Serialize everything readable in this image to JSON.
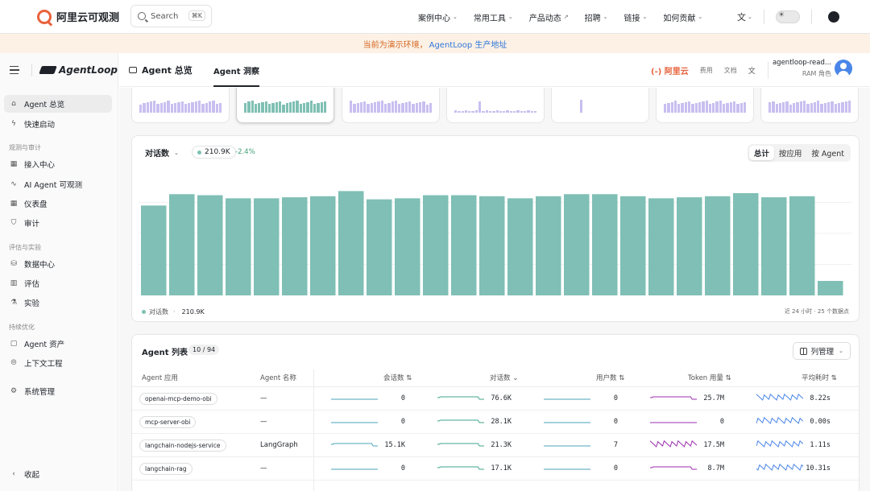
{
  "topnav": {
    "brand": "阿里云可观测",
    "search_label": "Search",
    "search_kbd": "⌘K",
    "links": [
      {
        "label": "案例中心",
        "suffix": "chevron"
      },
      {
        "label": "常用工具",
        "suffix": "chevron"
      },
      {
        "label": "产品动态",
        "suffix": "external"
      },
      {
        "label": "招聘",
        "suffix": "chevron"
      },
      {
        "label": "链接",
        "suffix": "chevron"
      },
      {
        "label": "如何贡献",
        "suffix": "chevron"
      }
    ]
  },
  "banner": {
    "text": "当前为演示环境，",
    "link": "AgentLoop 生产地址"
  },
  "sidebar": {
    "logo": "AgentLoop",
    "groups": [
      "观测与审计",
      "评估与实验",
      "持续优化"
    ],
    "items": [
      {
        "label": "Agent 总览",
        "icon": "home-icon"
      },
      {
        "label": "快速启动",
        "icon": "bolt-icon"
      },
      {
        "label": "接入中心",
        "icon": "grid-icon"
      },
      {
        "label": "AI Agent 可观测",
        "icon": "pulse-icon"
      },
      {
        "label": "仪表盘",
        "icon": "dashboard-icon"
      },
      {
        "label": "审计",
        "icon": "shield-icon"
      },
      {
        "label": "数据中心",
        "icon": "database-icon"
      },
      {
        "label": "评估",
        "icon": "chart-icon"
      },
      {
        "label": "实验",
        "icon": "flask-icon"
      },
      {
        "label": "Agent 资产",
        "icon": "folder-icon"
      },
      {
        "label": "上下文工程",
        "icon": "context-icon"
      },
      {
        "label": "系统管理",
        "icon": "settings-icon"
      }
    ],
    "collapse": "收起"
  },
  "header": {
    "tab1": "Agent 总览",
    "tab2": "Agent 洞察",
    "aliyun": "(-) 阿里云",
    "fee": "费用",
    "docs": "文档",
    "user": "agentloop-read...",
    "role": "RAM 角色"
  },
  "chart_card": {
    "metric": "对话数",
    "value": "210.9K",
    "delta": "-2.4%",
    "segments": [
      "总计",
      "按应用",
      "按 Agent"
    ],
    "legend_label": "对话数",
    "legend_value": "210.9K",
    "footnote": "近 24 小时 · 25 个数据点",
    "bar_color": "#7fbfb5"
  },
  "chart_data": {
    "type": "bar",
    "series": [
      {
        "name": "对话数",
        "values": [
          8.7,
          9.8,
          9.7,
          9.4,
          9.4,
          9.5,
          9.6,
          10.1,
          9.3,
          9.4,
          9.7,
          9.7,
          9.6,
          9.4,
          9.6,
          9.8,
          9.8,
          9.6,
          9.4,
          9.5,
          9.6,
          9.9,
          9.5,
          9.6,
          1.4
        ]
      }
    ],
    "title": "",
    "xlabel": "",
    "ylabel": "",
    "ylim": [
      0,
      12
    ],
    "grid": true,
    "legend": "bottom-left"
  },
  "table": {
    "title": "Agent 列表",
    "count": "10 / 94",
    "col_btn": "列管理",
    "headers": [
      "Agent 应用",
      "Agent 名称",
      "会话数 ⇅",
      "对话数 ⌄",
      "用户数 ⇅",
      "Token 用量 ⇅",
      "平均耗时 ⇅"
    ],
    "rows": [
      {
        "app": "openai-mcp-demo-obi",
        "name": "—",
        "sessions": "0",
        "convs": "76.6K",
        "users": "0",
        "tokens": "25.7M",
        "latency": "8.22s"
      },
      {
        "app": "mcp-server-obi",
        "name": "—",
        "sessions": "0",
        "convs": "28.1K",
        "users": "0",
        "tokens": "0",
        "latency": "0.00s"
      },
      {
        "app": "langchain-nodejs-service",
        "name": "LangGraph",
        "sessions": "15.1K",
        "convs": "21.3K",
        "users": "7",
        "tokens": "17.5M",
        "latency": "1.11s"
      },
      {
        "app": "langchain-rag",
        "name": "—",
        "sessions": "0",
        "convs": "17.1K",
        "users": "0",
        "tokens": "8.7M",
        "latency": "10.31s"
      }
    ],
    "spark_colors": {
      "sessions": "#4aa3b8",
      "convs": "#3fa58e",
      "users": "#4aa3b8",
      "tokens": "#9b2fae",
      "latency": "#4a86e8"
    }
  }
}
